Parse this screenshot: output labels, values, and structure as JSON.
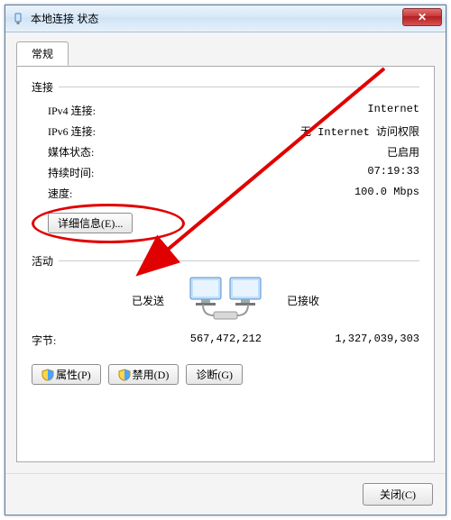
{
  "window": {
    "title": "本地连接 状态",
    "close_glyph": "✕"
  },
  "tab": {
    "general": "常规"
  },
  "connection": {
    "heading": "连接",
    "rows": {
      "ipv4_label": "IPv4 连接:",
      "ipv4_value": "Internet",
      "ipv6_label": "IPv6 连接:",
      "ipv6_value": "无 Internet 访问权限",
      "media_label": "媒体状态:",
      "media_value": "已启用",
      "duration_label": "持续时间:",
      "duration_value": "07:19:33",
      "speed_label": "速度:",
      "speed_value": "100.0 Mbps"
    },
    "details_button": "详细信息(E)..."
  },
  "activity": {
    "heading": "活动",
    "sent_label": "已发送",
    "recv_label": "已接收",
    "bytes_label": "字节:",
    "bytes_sent": "567,472,212",
    "bytes_recv": "1,327,039,303"
  },
  "buttons": {
    "properties": "属性(P)",
    "disable": "禁用(D)",
    "diagnose": "诊断(G)",
    "close": "关闭(C)"
  },
  "annotation": {
    "arrow_color": "#e00000"
  }
}
